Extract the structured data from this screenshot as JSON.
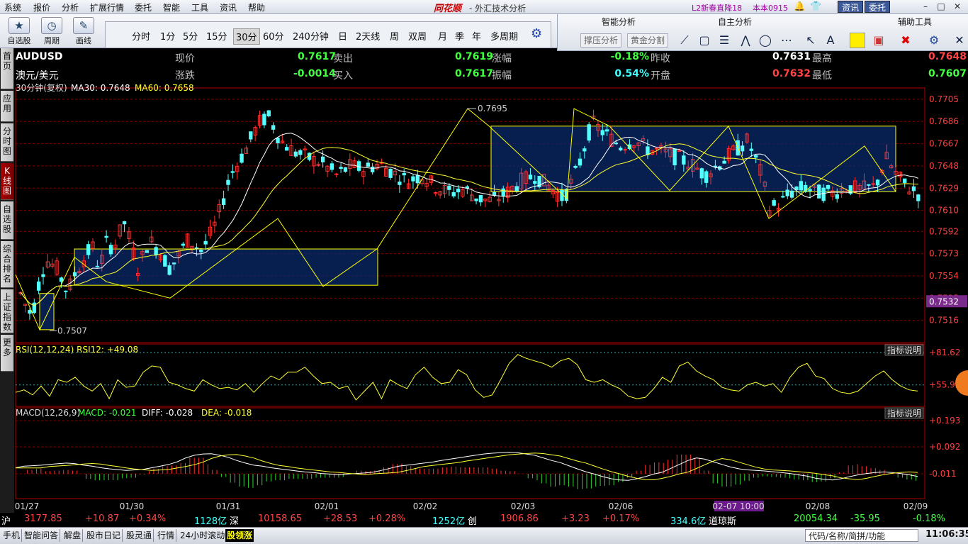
{
  "menu": {
    "items": [
      "系统",
      "报价",
      "分析",
      "扩展行情",
      "委托",
      "智能",
      "工具",
      "资讯",
      "帮助"
    ],
    "brand": "同花顺",
    "title": "- 外汇技术分析",
    "promo1": "L2新春直降18",
    "promo2": "本本0915",
    "btn_news": "资讯",
    "btn_trade": "委托"
  },
  "toolbar": {
    "b1": "自选股",
    "b2": "周期",
    "b3": "画线",
    "periods": [
      "分时",
      "1分",
      "5分",
      "15分",
      "30分",
      "60分",
      "240分钟",
      "日",
      "2天线",
      "周",
      "双周",
      "月",
      "季",
      "年",
      "多周期"
    ],
    "selected_period": "30分"
  },
  "rpanel": {
    "h1": "智能分析",
    "h2": "自主分析",
    "h3": "辅助工具",
    "s1": "撑压分析",
    "s2": "黄金分割"
  },
  "sidetabs": [
    "首页",
    "应用",
    "分时图",
    "K线图",
    "自选股",
    "综合排名",
    "上证指数",
    "更多"
  ],
  "info": {
    "code": "AUDUSD",
    "name": "澳元/美元",
    "l_price": "现价",
    "price": "0.7617",
    "l_chg": "涨跌",
    "chg": "-0.0014",
    "l_sell": "卖出",
    "sell": "0.7619",
    "l_buy": "买入",
    "buy": "0.7617",
    "l_pct": "涨幅",
    "pct": "-0.18%",
    "l_amp": "振幅",
    "amp": "0.54%",
    "l_prev": "昨收",
    "prev": "0.7631",
    "l_open": "开盘",
    "open": "0.7632",
    "l_high": "最高",
    "high": "0.7648",
    "l_low": "最低",
    "low": "0.7607"
  },
  "colors": {
    "up": "#ff3030",
    "down": "#54ffff",
    "box": "#ffff00",
    "boxfill": "#0a2a6a",
    "grid": "#7a0000",
    "axis": "#b00000",
    "ma30": "#ffffff",
    "ma60": "#ffff30"
  },
  "chart_data": {
    "type": "candlestick",
    "main": {
      "legend_period": "30分钟(复权)",
      "ma30_label": "MA30: 0.7648",
      "ma60_label": "MA60: 0.7658",
      "yticks": [
        "0.7705",
        "0.7686",
        "0.7667",
        "0.7648",
        "0.7629",
        "0.7610",
        "0.7592",
        "0.7573",
        "0.7554",
        "0.7535",
        "0.7516"
      ],
      "yrange": [
        0.7497,
        0.7711
      ],
      "current_price_label": "0.7532",
      "high_annotation": "0.7695",
      "low_annotation": "0.7507",
      "boxes": [
        {
          "x0": "01/27",
          "y0": 0.7508,
          "y1": 0.7539
        },
        {
          "x0": "01/27",
          "y0": 0.7546,
          "y1": 0.7577
        },
        {
          "x0": "02/02",
          "y0": 0.7626,
          "y1": 0.7682
        }
      ]
    },
    "rsi": {
      "label": "RSI(12,12,24) RSI12: +49.08",
      "yticks": [
        "+81.62",
        "+55.92"
      ],
      "help": "指标说明"
    },
    "macd": {
      "label_prefix": "MACD(12,26,9)",
      "macd": "MACD: -0.021",
      "diff": "DIFF: -0.028",
      "dea": "DEA: -0.018",
      "yticks": [
        "+0.193",
        "+0.092",
        "-0.011"
      ],
      "help": "指标说明"
    },
    "x_labels": [
      "01/27",
      "01/30",
      "01/31",
      "02/01",
      "02/02",
      "02/03",
      "02/06",
      "02-07 10:00",
      "02/08",
      "02/09"
    ],
    "series": [
      {
        "name": "RSI12",
        "values": [
          50,
          52,
          48,
          55,
          47,
          60,
          58,
          62,
          55,
          51,
          57,
          45,
          60,
          54,
          55,
          66,
          71,
          70,
          58,
          56,
          53,
          51,
          60,
          56,
          53,
          54,
          52,
          57,
          50,
          57,
          63,
          60,
          66,
          66,
          70,
          63,
          57,
          58,
          53,
          55,
          44,
          51,
          58,
          45,
          60,
          56,
          53,
          64,
          70,
          62,
          57,
          58,
          68,
          64,
          52,
          46,
          48,
          60,
          73,
          80,
          77,
          75,
          73,
          70,
          75,
          77,
          72,
          60,
          58,
          60,
          56,
          53,
          47,
          45,
          46,
          53,
          62,
          58,
          71,
          74,
          67,
          63,
          60,
          54,
          52,
          51,
          56,
          58,
          55,
          57,
          50,
          62,
          70,
          73,
          63,
          61,
          53,
          50,
          49,
          51,
          57,
          63,
          67,
          60,
          55,
          52,
          51
        ]
      },
      {
        "name": "MACD",
        "values": [
          0.012,
          0.018,
          0.02,
          0.022,
          0.025,
          0.028,
          0.03,
          0.028,
          0.022,
          0.018,
          0.012,
          0.008,
          0.005,
          0.002,
          0.004,
          0.006,
          0.012,
          0.018,
          0.025,
          0.035,
          0.05,
          0.06,
          0.065,
          0.066,
          0.06,
          0.052,
          0.04,
          0.03,
          0.022,
          0.018,
          0.012,
          0.008,
          0.004,
          0.0,
          -0.004,
          -0.006,
          -0.01,
          -0.012,
          -0.015,
          -0.012,
          -0.01,
          -0.008,
          -0.005,
          0.002,
          0.01,
          0.018,
          0.022,
          0.026,
          0.03,
          0.034,
          0.04,
          0.045,
          0.05,
          0.055,
          0.06,
          0.065,
          0.068,
          0.07,
          0.072,
          0.07,
          0.065,
          0.06,
          0.05,
          0.04,
          0.032,
          0.02,
          0.008,
          -0.003,
          -0.012,
          -0.022,
          -0.03,
          -0.035,
          -0.036,
          -0.03,
          -0.022,
          -0.012,
          -0.005,
          0.01,
          0.025,
          0.04,
          0.05,
          0.045,
          0.035,
          0.025,
          0.015,
          0.008,
          0.004,
          0.002,
          0.0,
          -0.003,
          -0.006,
          -0.01,
          -0.015,
          -0.02,
          -0.028,
          -0.032,
          -0.035,
          -0.03,
          -0.022,
          -0.015,
          -0.01,
          -0.006,
          -0.004,
          -0.006,
          -0.01,
          -0.015,
          -0.021
        ]
      }
    ]
  },
  "status": {
    "sh_label": "沪",
    "sh_val": "3177.85",
    "sh_chg": "+10.87",
    "sh_pct": "+0.34%",
    "sh_vol": "1128亿",
    "sz_label": "深",
    "sz_val": "10158.65",
    "sz_chg": "+28.53",
    "sz_pct": "+0.28%",
    "sz_vol": "1252亿",
    "cy_label": "创",
    "cy_val": "1906.86",
    "cy_chg": "+3.23",
    "cy_pct": "+0.17%",
    "cy_vol": "334.6亿",
    "dj_label": "道琼斯",
    "dj_val": "20054.34",
    "dj_chg": "-35.95",
    "dj_pct": "-0.18%"
  },
  "bottom": {
    "items": [
      "手机",
      "智能问答",
      "解盘",
      "股市日记",
      "股灵通",
      "行情",
      "24小时滚动"
    ],
    "ticker": "股领涨",
    "search_placeholder": "代码/名称/简拼/功能",
    "time": "11:06:35"
  }
}
